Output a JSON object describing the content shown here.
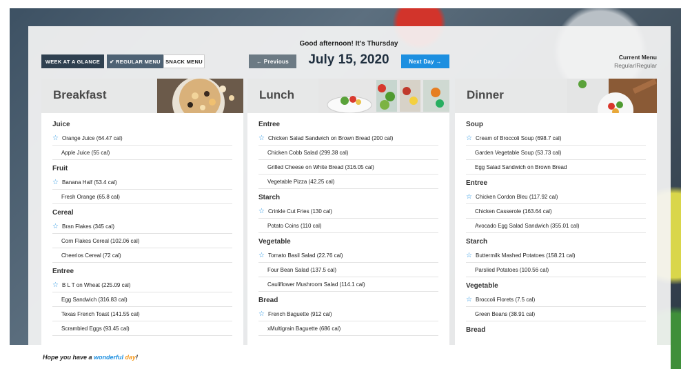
{
  "header": {
    "greeting": "Good afternoon! It's Thursday",
    "date": "July 15, 2020",
    "buttons": {
      "week": "WEEK AT A GLANCE",
      "regular": "✔ REGULAR MENU",
      "snack": "SNACK MENU",
      "previous": "← Previous",
      "next": "Next Day →"
    },
    "current_menu_label": "Current Menu",
    "current_menu_value": "Regular/Regular"
  },
  "columns": [
    {
      "title": "Breakfast",
      "categories": [
        {
          "name": "Juice",
          "items": [
            {
              "text": "Orange Juice (64.47 cal)",
              "star": true
            },
            {
              "text": "Apple Juice (55 cal)",
              "star": false
            }
          ]
        },
        {
          "name": "Fruit",
          "items": [
            {
              "text": "Banana Half (53.4 cal)",
              "star": true
            },
            {
              "text": "Fresh Orange (65.8 cal)",
              "star": false
            }
          ]
        },
        {
          "name": "Cereal",
          "items": [
            {
              "text": "Bran Flakes (345 cal)",
              "star": true
            },
            {
              "text": "Corn Flakes Cereal (102.06 cal)",
              "star": false
            },
            {
              "text": "Cheerios Cereal (72 cal)",
              "star": false
            }
          ]
        },
        {
          "name": "Entree",
          "items": [
            {
              "text": "B L T on Wheat (225.09 cal)",
              "star": true
            },
            {
              "text": "Egg Sandwich (316.83 cal)",
              "star": false
            },
            {
              "text": "Texas French Toast (141.55 cal)",
              "star": false
            },
            {
              "text": "Scrambled Eggs (93.45 cal)",
              "star": false
            }
          ]
        }
      ]
    },
    {
      "title": "Lunch",
      "categories": [
        {
          "name": "Entree",
          "items": [
            {
              "text": "Chicken Salad Sandwich on Brown Bread (200 cal)",
              "star": true
            },
            {
              "text": "Chicken Cobb Salad (299.38 cal)",
              "star": false
            },
            {
              "text": "Grilled Cheese on White Bread (316.05 cal)",
              "star": false
            },
            {
              "text": "Vegetable Pizza (42.25 cal)",
              "star": false
            }
          ]
        },
        {
          "name": "Starch",
          "items": [
            {
              "text": "Crinkle Cut Fries (130 cal)",
              "star": true
            },
            {
              "text": "Potato Coins (110 cal)",
              "star": false
            }
          ]
        },
        {
          "name": "Vegetable",
          "items": [
            {
              "text": "Tomato Basil Salad (22.76 cal)",
              "star": true
            },
            {
              "text": "Four Bean Salad (137.5 cal)",
              "star": false
            },
            {
              "text": "Cauliflower Mushroom Salad (114.1 cal)",
              "star": false
            }
          ]
        },
        {
          "name": "Bread",
          "items": [
            {
              "text": "French Baguette (912 cal)",
              "star": true
            },
            {
              "text": "xMultigrain Baguette (686 cal)",
              "star": false
            }
          ]
        }
      ]
    },
    {
      "title": "Dinner",
      "categories": [
        {
          "name": "Soup",
          "items": [
            {
              "text": "Cream of Broccoli Soup (698.7 cal)",
              "star": true
            },
            {
              "text": "Garden Vegetable Soup (53.73 cal)",
              "star": false
            },
            {
              "text": "Egg Salad Sandwich on Brown Bread",
              "star": false
            }
          ]
        },
        {
          "name": "Entree",
          "items": [
            {
              "text": "Chicken Cordon Bleu (117.92 cal)",
              "star": true
            },
            {
              "text": "Chicken Casserole (163.64 cal)",
              "star": false
            },
            {
              "text": "Avocado Egg Salad Sandwich (355.01 cal)",
              "star": false
            }
          ]
        },
        {
          "name": "Starch",
          "items": [
            {
              "text": "Buttermilk Mashed Potatoes (158.21 cal)",
              "star": true
            },
            {
              "text": "Parslied Potatoes (100.56 cal)",
              "star": false
            }
          ]
        },
        {
          "name": "Vegetable",
          "items": [
            {
              "text": "Broccoli Florets (7.5 cal)",
              "star": true
            },
            {
              "text": "Green Beans (38.91 cal)",
              "star": false
            }
          ]
        },
        {
          "name": "Bread",
          "items": []
        }
      ]
    }
  ],
  "footer": {
    "prefix": "Hope you have a ",
    "word1": "wonderful",
    "word2": "day",
    "suffix": "!"
  },
  "colors": {
    "accent_blue": "#1c8fe0",
    "accent_orange": "#f59b22",
    "dark_button": "#2f4050"
  },
  "icons": {
    "star": "star-outline-icon",
    "check": "checkmark-icon",
    "arrow_left": "arrow-left-icon",
    "arrow_right": "arrow-right-icon"
  }
}
